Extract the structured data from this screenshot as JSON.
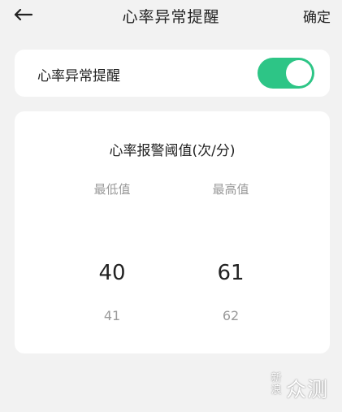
{
  "header": {
    "title": "心率异常提醒",
    "confirm_label": "确定",
    "back_icon": "back-arrow-icon"
  },
  "toggle_card": {
    "label": "心率异常提醒",
    "enabled": true,
    "accent_color": "#2dc586"
  },
  "threshold_picker": {
    "title": "心率报警阈值(次/分)",
    "min": {
      "header": "最低值",
      "selected": "40",
      "next": "41"
    },
    "max": {
      "header": "最高值",
      "selected": "61",
      "next": "62"
    }
  },
  "watermark": {
    "stamp_top": "新",
    "stamp_bottom": "浪",
    "text": "众测"
  }
}
